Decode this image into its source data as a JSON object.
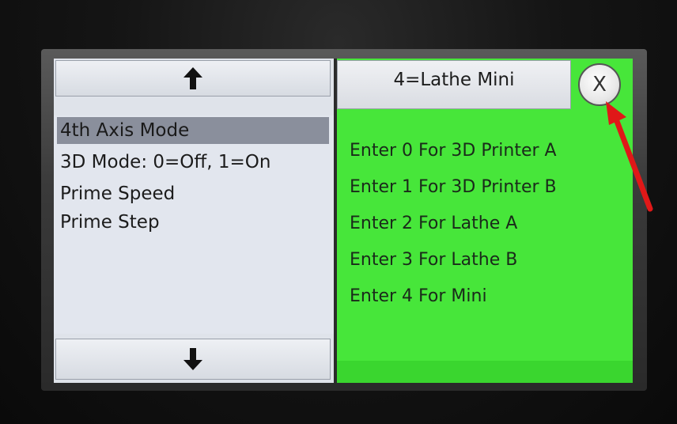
{
  "left_panel": {
    "scroll_up_icon": "up-arrow",
    "scroll_down_icon": "down-arrow",
    "menu_items": [
      {
        "label": "4th Axis Mode",
        "selected": true
      },
      {
        "label": "3D Mode: 0=Off, 1=On",
        "selected": false
      },
      {
        "label": "Prime Speed",
        "selected": false
      },
      {
        "label": "Prime Step",
        "selected": false
      }
    ]
  },
  "right_panel": {
    "current_value": "4=Lathe Mini",
    "close_label": "X",
    "options": [
      "Enter 0 For 3D Printer A",
      "Enter 1 For 3D Printer B",
      "Enter 2 For Lathe A",
      "Enter 3 For Lathe B",
      "Enter 4 For Mini"
    ]
  },
  "colors": {
    "panel_green": "#47e63a",
    "menu_bg": "#e2e6ee",
    "selected_bg": "#8a8f9c",
    "annotation_red": "#e01818"
  }
}
